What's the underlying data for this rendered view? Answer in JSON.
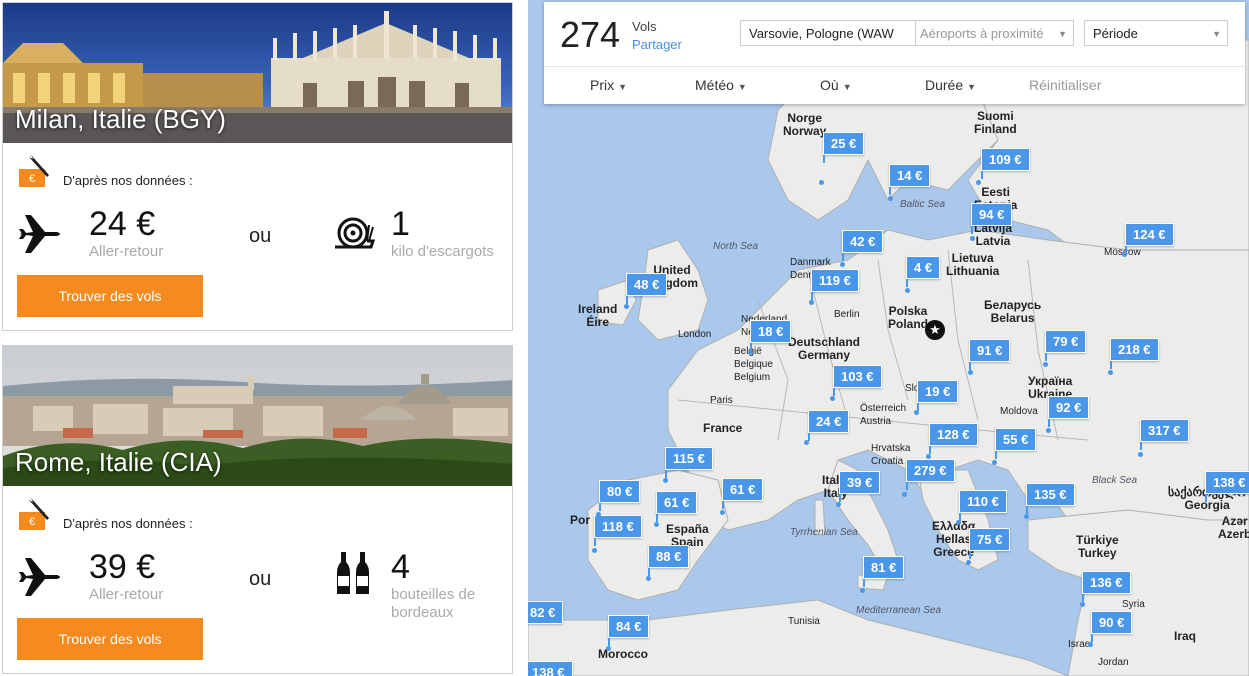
{
  "cards": [
    {
      "city": "Milan, Italie (BGY)",
      "data_note": "D'après nos données :",
      "price": "24 €",
      "price_sub": "Aller-retour",
      "or": "ou",
      "alt_num": "1",
      "alt_sub": "kilo d'escargots",
      "alt_icon": "snail-icon",
      "button": "Trouver des vols"
    },
    {
      "city": "Rome, Italie (CIA)",
      "data_note": "D'après nos données :",
      "price": "39 €",
      "price_sub": "Aller-retour",
      "or": "ou",
      "alt_num": "4",
      "alt_sub": "bouteilles de bordeaux",
      "alt_icon": "wine-bottles-icon",
      "button": "Trouver des vols"
    }
  ],
  "panel": {
    "count": "274",
    "count_label": "Vols",
    "share": "Partager",
    "origin": "Varsovie, Pologne (WAW",
    "nearby_placeholder": "Aéroports à proximité",
    "period": "Période",
    "filters": [
      "Prix",
      "Météo",
      "Où",
      "Durée"
    ],
    "reset": "Réinitialiser"
  },
  "map": {
    "countries": [
      "Norge\nNorway",
      "Suomi\nFinland",
      "Eesti\nEstonia",
      "Latvija\nLatvia",
      "Lietuva\nLithuania",
      "United\nKingdom",
      "Ireland\nÉire",
      "Nederland\nNederland",
      "Deutschland\nGermany",
      "België\nBelgique\nBelgium",
      "Polska\nPoland",
      "Беларусь\nBelarus",
      "Україна\nUkraine",
      "Moldova",
      "France",
      "Österreich\nAustria",
      "Slo",
      "Hrvatska\nCroatia",
      "Italia\nItaly",
      "España\nSpain",
      "Por",
      "Ελλάδα\nHellas\nGreece",
      "Türkiye\nTurkey",
      "საქართველო\nGeorgia",
      "Azər\nAzerb",
      "Syria",
      "Iraq",
      "Israel",
      "Jordan",
      "Tunisia",
      "Morocco",
      "Danmark\nDenmark"
    ],
    "seas": [
      "North Sea",
      "Baltic Sea",
      "Black Sea",
      "Tyrrhenian Sea",
      "Mediterranean Sea"
    ],
    "cities": [
      "London",
      "Paris",
      "Berlin",
      "Moscow"
    ],
    "prices": [
      "25 €",
      "14 €",
      "109 €",
      "94 €",
      "42 €",
      "124 €",
      "4 €",
      "119 €",
      "48 €",
      "18 €",
      "91 €",
      "79 €",
      "218 €",
      "103 €",
      "19 €",
      "92 €",
      "24 €",
      "128 €",
      "55 €",
      "317 €",
      "115 €",
      "279 €",
      "80 €",
      "61 €",
      "61 €",
      "39 €",
      "110 €",
      "135 €",
      "138 €",
      "118 €",
      "75 €",
      "88 €",
      "81 €",
      "136 €",
      "82 €",
      "84 €",
      "90 €",
      "138 €"
    ],
    "home_marker": "★"
  }
}
